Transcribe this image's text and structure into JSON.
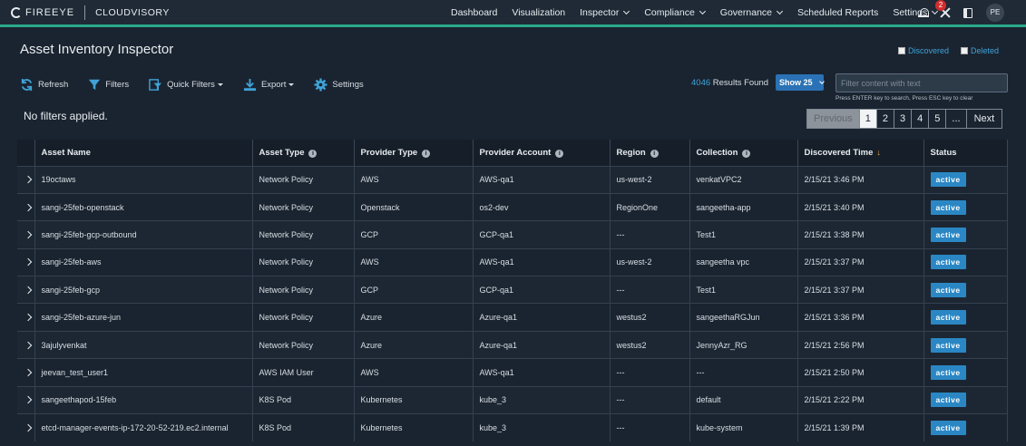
{
  "brand": {
    "logo": "FIREEYE",
    "product": "CLOUDVISORY"
  },
  "nav": [
    {
      "label": "Dashboard",
      "dropdown": false
    },
    {
      "label": "Visualization",
      "dropdown": false
    },
    {
      "label": "Inspector",
      "dropdown": true
    },
    {
      "label": "Compliance",
      "dropdown": true
    },
    {
      "label": "Governance",
      "dropdown": true
    },
    {
      "label": "Scheduled Reports",
      "dropdown": false
    },
    {
      "label": "Settings",
      "dropdown": true
    }
  ],
  "notifications": {
    "count": "2"
  },
  "user": {
    "initials": "PE"
  },
  "page": {
    "title": "Asset Inventory Inspector"
  },
  "filters": {
    "discovered": "Discovered",
    "deleted": "Deleted"
  },
  "toolbar": {
    "refresh": "Refresh",
    "filters": "Filters",
    "quick_filters": "Quick Filters",
    "export": "Export",
    "settings": "Settings"
  },
  "results": {
    "count": "4046",
    "label": "Results Found",
    "show": "Show 25"
  },
  "search": {
    "placeholder": "Filter content with text",
    "hint": "Press ENTER key to search, Press ESC key to clear"
  },
  "no_filters": "No filters applied.",
  "pagination": {
    "previous": "Previous",
    "pages": [
      "1",
      "2",
      "3",
      "4",
      "5",
      "..."
    ],
    "next": "Next",
    "current": "1"
  },
  "table": {
    "columns": [
      "",
      "Asset Name",
      "Asset Type",
      "Provider Type",
      "Provider Account",
      "Region",
      "Collection",
      "Discovered Time",
      "Status"
    ],
    "rows": [
      [
        "19octaws",
        "Network Policy",
        "AWS",
        "AWS-qa1",
        "us-west-2",
        "venkatVPC2",
        "2/15/21 3:46 PM",
        "active"
      ],
      [
        "sangi-25feb-openstack",
        "Network Policy",
        "Openstack",
        "os2-dev",
        "RegionOne",
        "sangeetha-app",
        "2/15/21 3:40 PM",
        "active"
      ],
      [
        "sangi-25feb-gcp-outbound",
        "Network Policy",
        "GCP",
        "GCP-qa1",
        "---",
        "Test1",
        "2/15/21 3:38 PM",
        "active"
      ],
      [
        "sangi-25feb-aws",
        "Network Policy",
        "AWS",
        "AWS-qa1",
        "us-west-2",
        "sangeetha vpc",
        "2/15/21 3:37 PM",
        "active"
      ],
      [
        "sangi-25feb-gcp",
        "Network Policy",
        "GCP",
        "GCP-qa1",
        "---",
        "Test1",
        "2/15/21 3:37 PM",
        "active"
      ],
      [
        "sangi-25feb-azure-jun",
        "Network Policy",
        "Azure",
        "Azure-qa1",
        "westus2",
        "sangeethaRGJun",
        "2/15/21 3:36 PM",
        "active"
      ],
      [
        "3ajulyvenkat",
        "Network Policy",
        "Azure",
        "Azure-qa1",
        "westus2",
        "JennyAzr_RG",
        "2/15/21 2:56 PM",
        "active"
      ],
      [
        "jeevan_test_user1",
        "AWS IAM User",
        "AWS",
        "AWS-qa1",
        "---",
        "---",
        "2/15/21 2:50 PM",
        "active"
      ],
      [
        "sangeethapod-15feb",
        "K8S Pod",
        "Kubernetes",
        "kube_3",
        "---",
        "default",
        "2/15/21 2:22 PM",
        "active"
      ],
      [
        "etcd-manager-events-ip-172-20-52-219.ec2.internal",
        "K8S Pod",
        "Kubernetes",
        "kube_3",
        "---",
        "kube-system",
        "2/15/21 1:39 PM",
        "active"
      ]
    ]
  },
  "colors": {
    "accent": "#29a98b",
    "status_active": "#2b87c4",
    "link": "#3fa3d8",
    "notification": "#d12d2d"
  }
}
